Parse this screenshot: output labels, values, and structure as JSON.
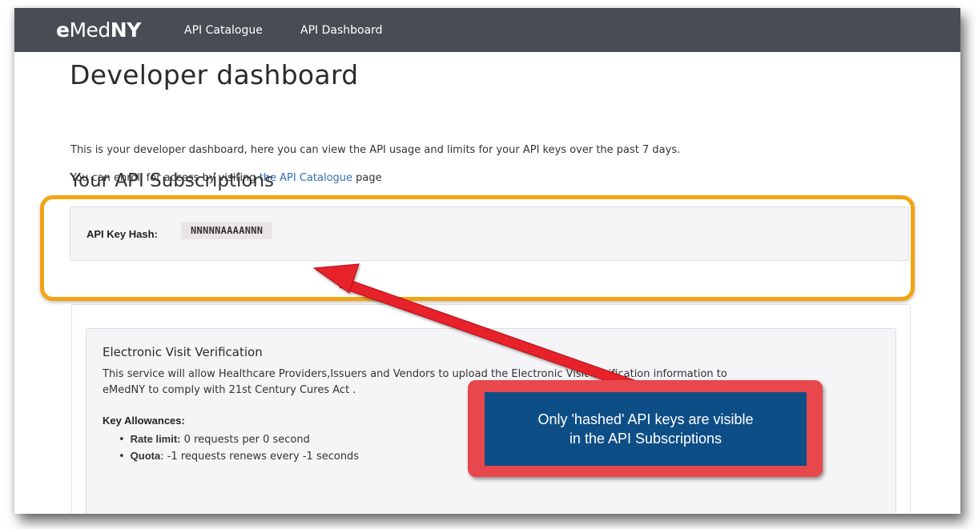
{
  "nav": {
    "logo_e": "e",
    "logo_med": "Med",
    "logo_ny": "NY",
    "links": [
      "API Catalogue",
      "API Dashboard"
    ]
  },
  "page": {
    "title": "Developer dashboard",
    "intro_line1": "This is your developer dashboard, here you can view the API usage and limits for your API keys over the past 7 days.",
    "intro_line2_before": "You can enroll for access by visiting ",
    "intro_line2_link": "the API Catalogue",
    "intro_line2_after": " page"
  },
  "subscriptions": {
    "title": "Your API Subscriptions",
    "key_label": "API Key Hash:",
    "key_value": "NNNNNAAAANNN"
  },
  "service": {
    "name": "Electronic Visit Verification",
    "description_line1": "This service will allow Healthcare Providers,Issuers and Vendors to upload the Electronic Visit Verification information to",
    "description_line2": "eMedNY to comply with 21st Century Cures Act .",
    "allowances_heading": "Key Allowances:",
    "allowances": [
      {
        "label": "Rate limit:",
        "text": " 0 requests per 0 second"
      },
      {
        "label": "Quota",
        "text": ": -1 requests renews every -1 seconds"
      }
    ]
  },
  "callout": {
    "line1": "Only 'hashed' API keys are visible",
    "line2": "in the API Subscriptions"
  },
  "colors": {
    "nav_bg": "#474c55",
    "highlight": "#f2a413",
    "arrow": "#e8202a",
    "callout_border": "#e8474c",
    "callout_bg": "#0e4e86",
    "link": "#2f6db5"
  }
}
